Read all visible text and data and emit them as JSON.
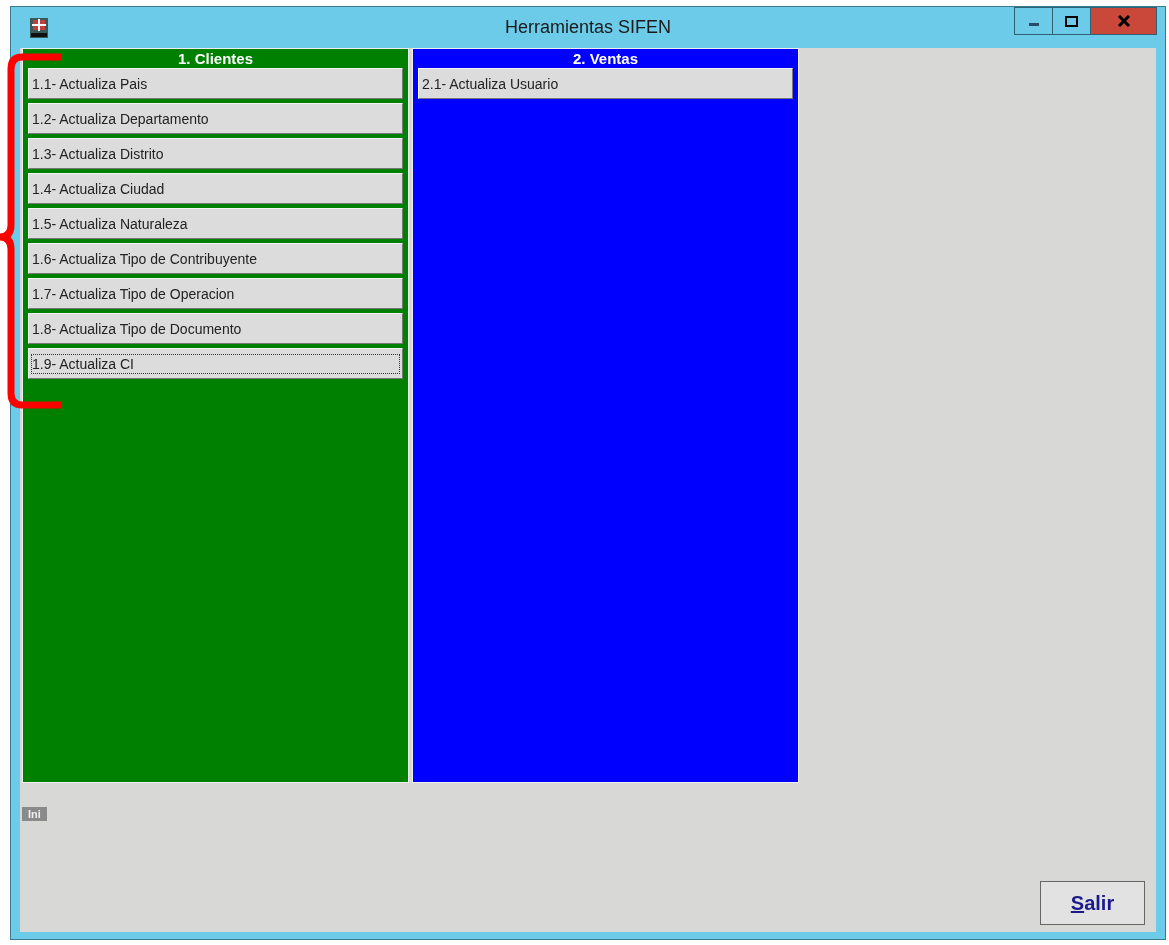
{
  "window": {
    "title": "Herramientas SIFEN"
  },
  "panels": [
    {
      "title": "1. Clientes",
      "color": "#008000",
      "items": [
        {
          "label": "1.1- Actualiza Pais",
          "focused": false
        },
        {
          "label": "1.2- Actualiza Departamento",
          "focused": false
        },
        {
          "label": "1.3- Actualiza Distrito",
          "focused": false
        },
        {
          "label": "1.4- Actualiza Ciudad",
          "focused": false
        },
        {
          "label": "1.5- Actualiza Naturaleza",
          "focused": false
        },
        {
          "label": "1.6- Actualiza Tipo de Contribuyente",
          "focused": false
        },
        {
          "label": "1.7- Actualiza Tipo de Operacion",
          "focused": false
        },
        {
          "label": "1.8- Actualiza Tipo de Documento",
          "focused": false
        },
        {
          "label": "1.9- Actualiza CI",
          "focused": true
        }
      ]
    },
    {
      "title": "2. Ventas",
      "color": "#0000ff",
      "items": [
        {
          "label": "2.1- Actualiza Usuario",
          "focused": false
        }
      ]
    }
  ],
  "status_tag": "Ini",
  "exit_button": {
    "mnemonic": "S",
    "rest": "alir"
  }
}
